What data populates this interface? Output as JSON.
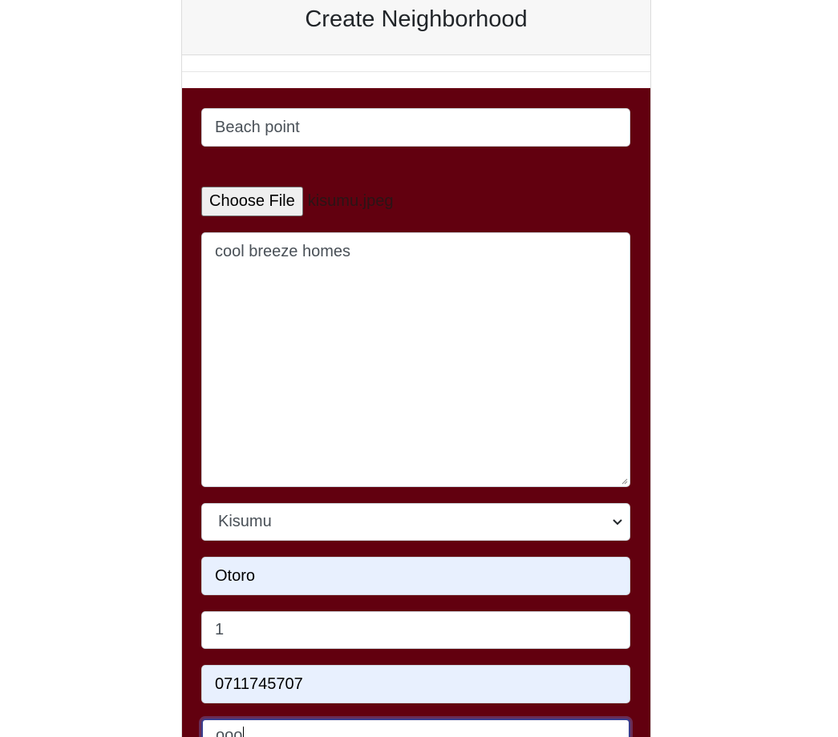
{
  "header": {
    "title": "Create Neighborhood"
  },
  "form": {
    "name_value": "Beach point",
    "file_button_label": "Choose File",
    "file_name": "kisumu.jpeg",
    "description_value": "cool breeze homes",
    "location_selected": "Kisumu",
    "estate_value": "Otoro",
    "occupants_value": "1",
    "phone_value": "0711745707",
    "last_value": "ooo"
  },
  "colors": {
    "form_background": "#62000f",
    "autofill_background": "#e8f0fe",
    "header_background": "#f7f7f7"
  }
}
